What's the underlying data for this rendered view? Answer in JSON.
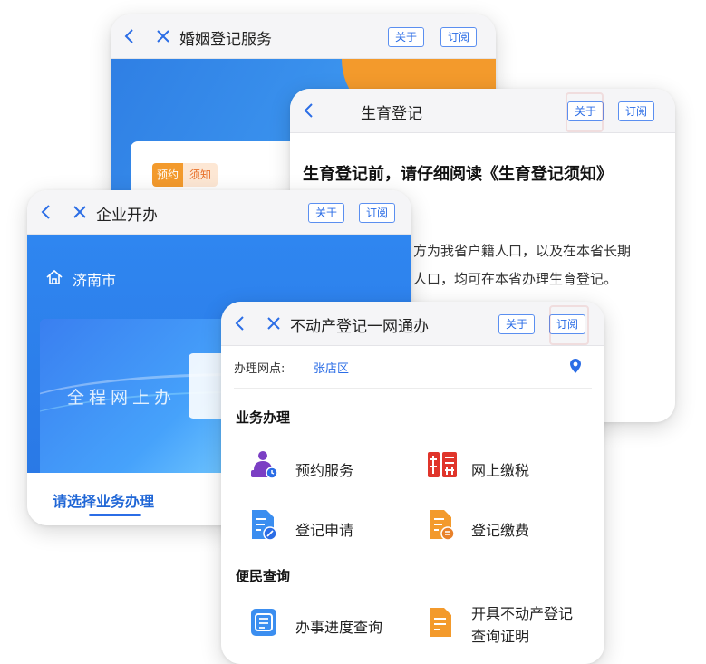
{
  "colors": {
    "accent": "#2b6de6",
    "orange": "#f39a2c",
    "red": "#e0352b"
  },
  "marriage_card": {
    "title": "婚姻登记服务",
    "about_label": "关于",
    "subscribe_label": "订阅",
    "tag_left": "预约",
    "tag_right": "须知"
  },
  "birth_card": {
    "title": "生育登记",
    "about_label": "关于",
    "subscribe_label": "订阅",
    "headline": "生育登记前，请仔细阅读《生育登记须知》",
    "paragraph_line1": "方为我省户籍人口，以及在本省长期",
    "paragraph_line2": "人口，均可在本省办理生育登记。"
  },
  "enterprise_card": {
    "title": "企业开办",
    "about_label": "关于",
    "subscribe_label": "订阅",
    "city": "济南市",
    "banner_slogan": "全程网上办",
    "section_tab": "请选择业务办理"
  },
  "realestate_card": {
    "title": "不动产登记一网通办",
    "about_label": "关于",
    "subscribe_label": "订阅",
    "location_label": "办理网点:",
    "location_value": "张店区",
    "section_business": "业务办理",
    "section_query": "便民查询",
    "items": [
      {
        "label": "预约服务",
        "icon": "appointment-icon"
      },
      {
        "label": "网上缴税",
        "icon": "tax-icon"
      },
      {
        "label": "登记申请",
        "icon": "registration-apply-icon"
      },
      {
        "label": "登记缴费",
        "icon": "registration-fee-icon"
      },
      {
        "label": "办事进度查询",
        "icon": "progress-query-icon"
      },
      {
        "label": "开具不动产登记",
        "icon": "certificate-icon"
      },
      {
        "label": "查询证明",
        "icon": "certificate-icon"
      }
    ]
  }
}
